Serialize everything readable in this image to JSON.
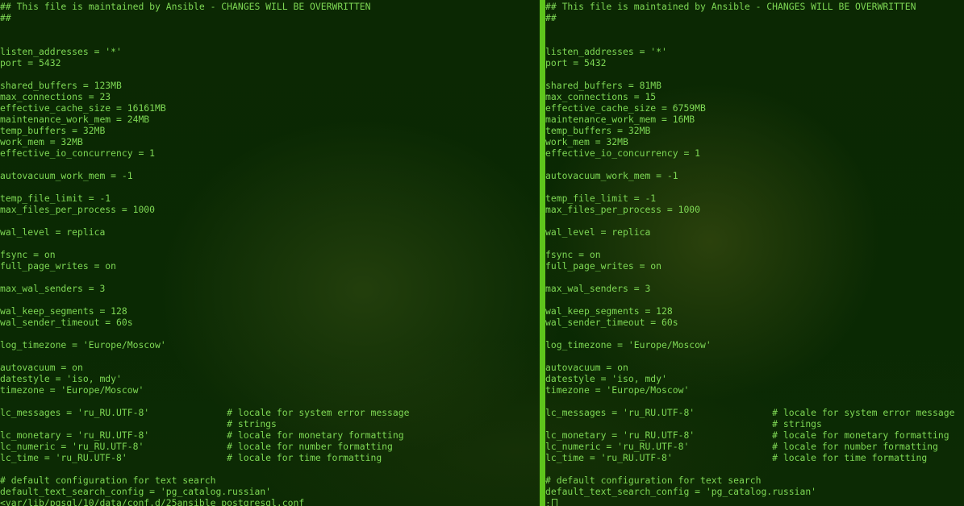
{
  "left_pane": {
    "lines": [
      "## This file is maintained by Ansible - CHANGES WILL BE OVERWRITTEN",
      "##",
      "",
      "",
      "listen_addresses = '*'",
      "port = 5432",
      "",
      "shared_buffers = 123MB",
      "max_connections = 23",
      "effective_cache_size = 16161MB",
      "maintenance_work_mem = 24MB",
      "temp_buffers = 32MB",
      "work_mem = 32MB",
      "effective_io_concurrency = 1",
      "",
      "autovacuum_work_mem = -1",
      "",
      "temp_file_limit = -1",
      "max_files_per_process = 1000",
      "",
      "wal_level = replica",
      "",
      "fsync = on",
      "full_page_writes = on",
      "",
      "max_wal_senders = 3",
      "",
      "wal_keep_segments = 128",
      "wal_sender_timeout = 60s",
      "",
      "log_timezone = 'Europe/Moscow'",
      "",
      "autovacuum = on",
      "datestyle = 'iso, mdy'",
      "timezone = 'Europe/Moscow'",
      "",
      "lc_messages = 'ru_RU.UTF-8'              # locale for system error message",
      "                                         # strings",
      "lc_monetary = 'ru_RU.UTF-8'              # locale for monetary formatting",
      "lc_numeric = 'ru_RU.UTF-8'               # locale for number formatting",
      "lc_time = 'ru_RU.UTF-8'                  # locale for time formatting",
      "",
      "# default configuration for text search",
      "default_text_search_config = 'pg_catalog.russian'",
      "<var/lib/pgsql/10/data/conf.d/25ansible_postgresql.conf"
    ]
  },
  "right_pane": {
    "lines": [
      "## This file is maintained by Ansible - CHANGES WILL BE OVERWRITTEN",
      "##",
      "",
      "",
      "listen_addresses = '*'",
      "port = 5432",
      "",
      "shared_buffers = 81MB",
      "max_connections = 15",
      "effective_cache_size = 6759MB",
      "maintenance_work_mem = 16MB",
      "temp_buffers = 32MB",
      "work_mem = 32MB",
      "effective_io_concurrency = 1",
      "",
      "autovacuum_work_mem = -1",
      "",
      "temp_file_limit = -1",
      "max_files_per_process = 1000",
      "",
      "wal_level = replica",
      "",
      "fsync = on",
      "full_page_writes = on",
      "",
      "max_wal_senders = 3",
      "",
      "wal_keep_segments = 128",
      "wal_sender_timeout = 60s",
      "",
      "log_timezone = 'Europe/Moscow'",
      "",
      "autovacuum = on",
      "datestyle = 'iso, mdy'",
      "timezone = 'Europe/Moscow'",
      "",
      "lc_messages = 'ru_RU.UTF-8'              # locale for system error message",
      "                                         # strings",
      "lc_monetary = 'ru_RU.UTF-8'              # locale for monetary formatting",
      "lc_numeric = 'ru_RU.UTF-8'               # locale for number formatting",
      "lc_time = 'ru_RU.UTF-8'                  # locale for time formatting",
      "",
      "# default configuration for text search",
      "default_text_search_config = 'pg_catalog.russian'"
    ],
    "command_prompt": ":"
  },
  "colors": {
    "text": "#7ed854",
    "divider": "#5ec41c",
    "background": "#0a2a02"
  }
}
